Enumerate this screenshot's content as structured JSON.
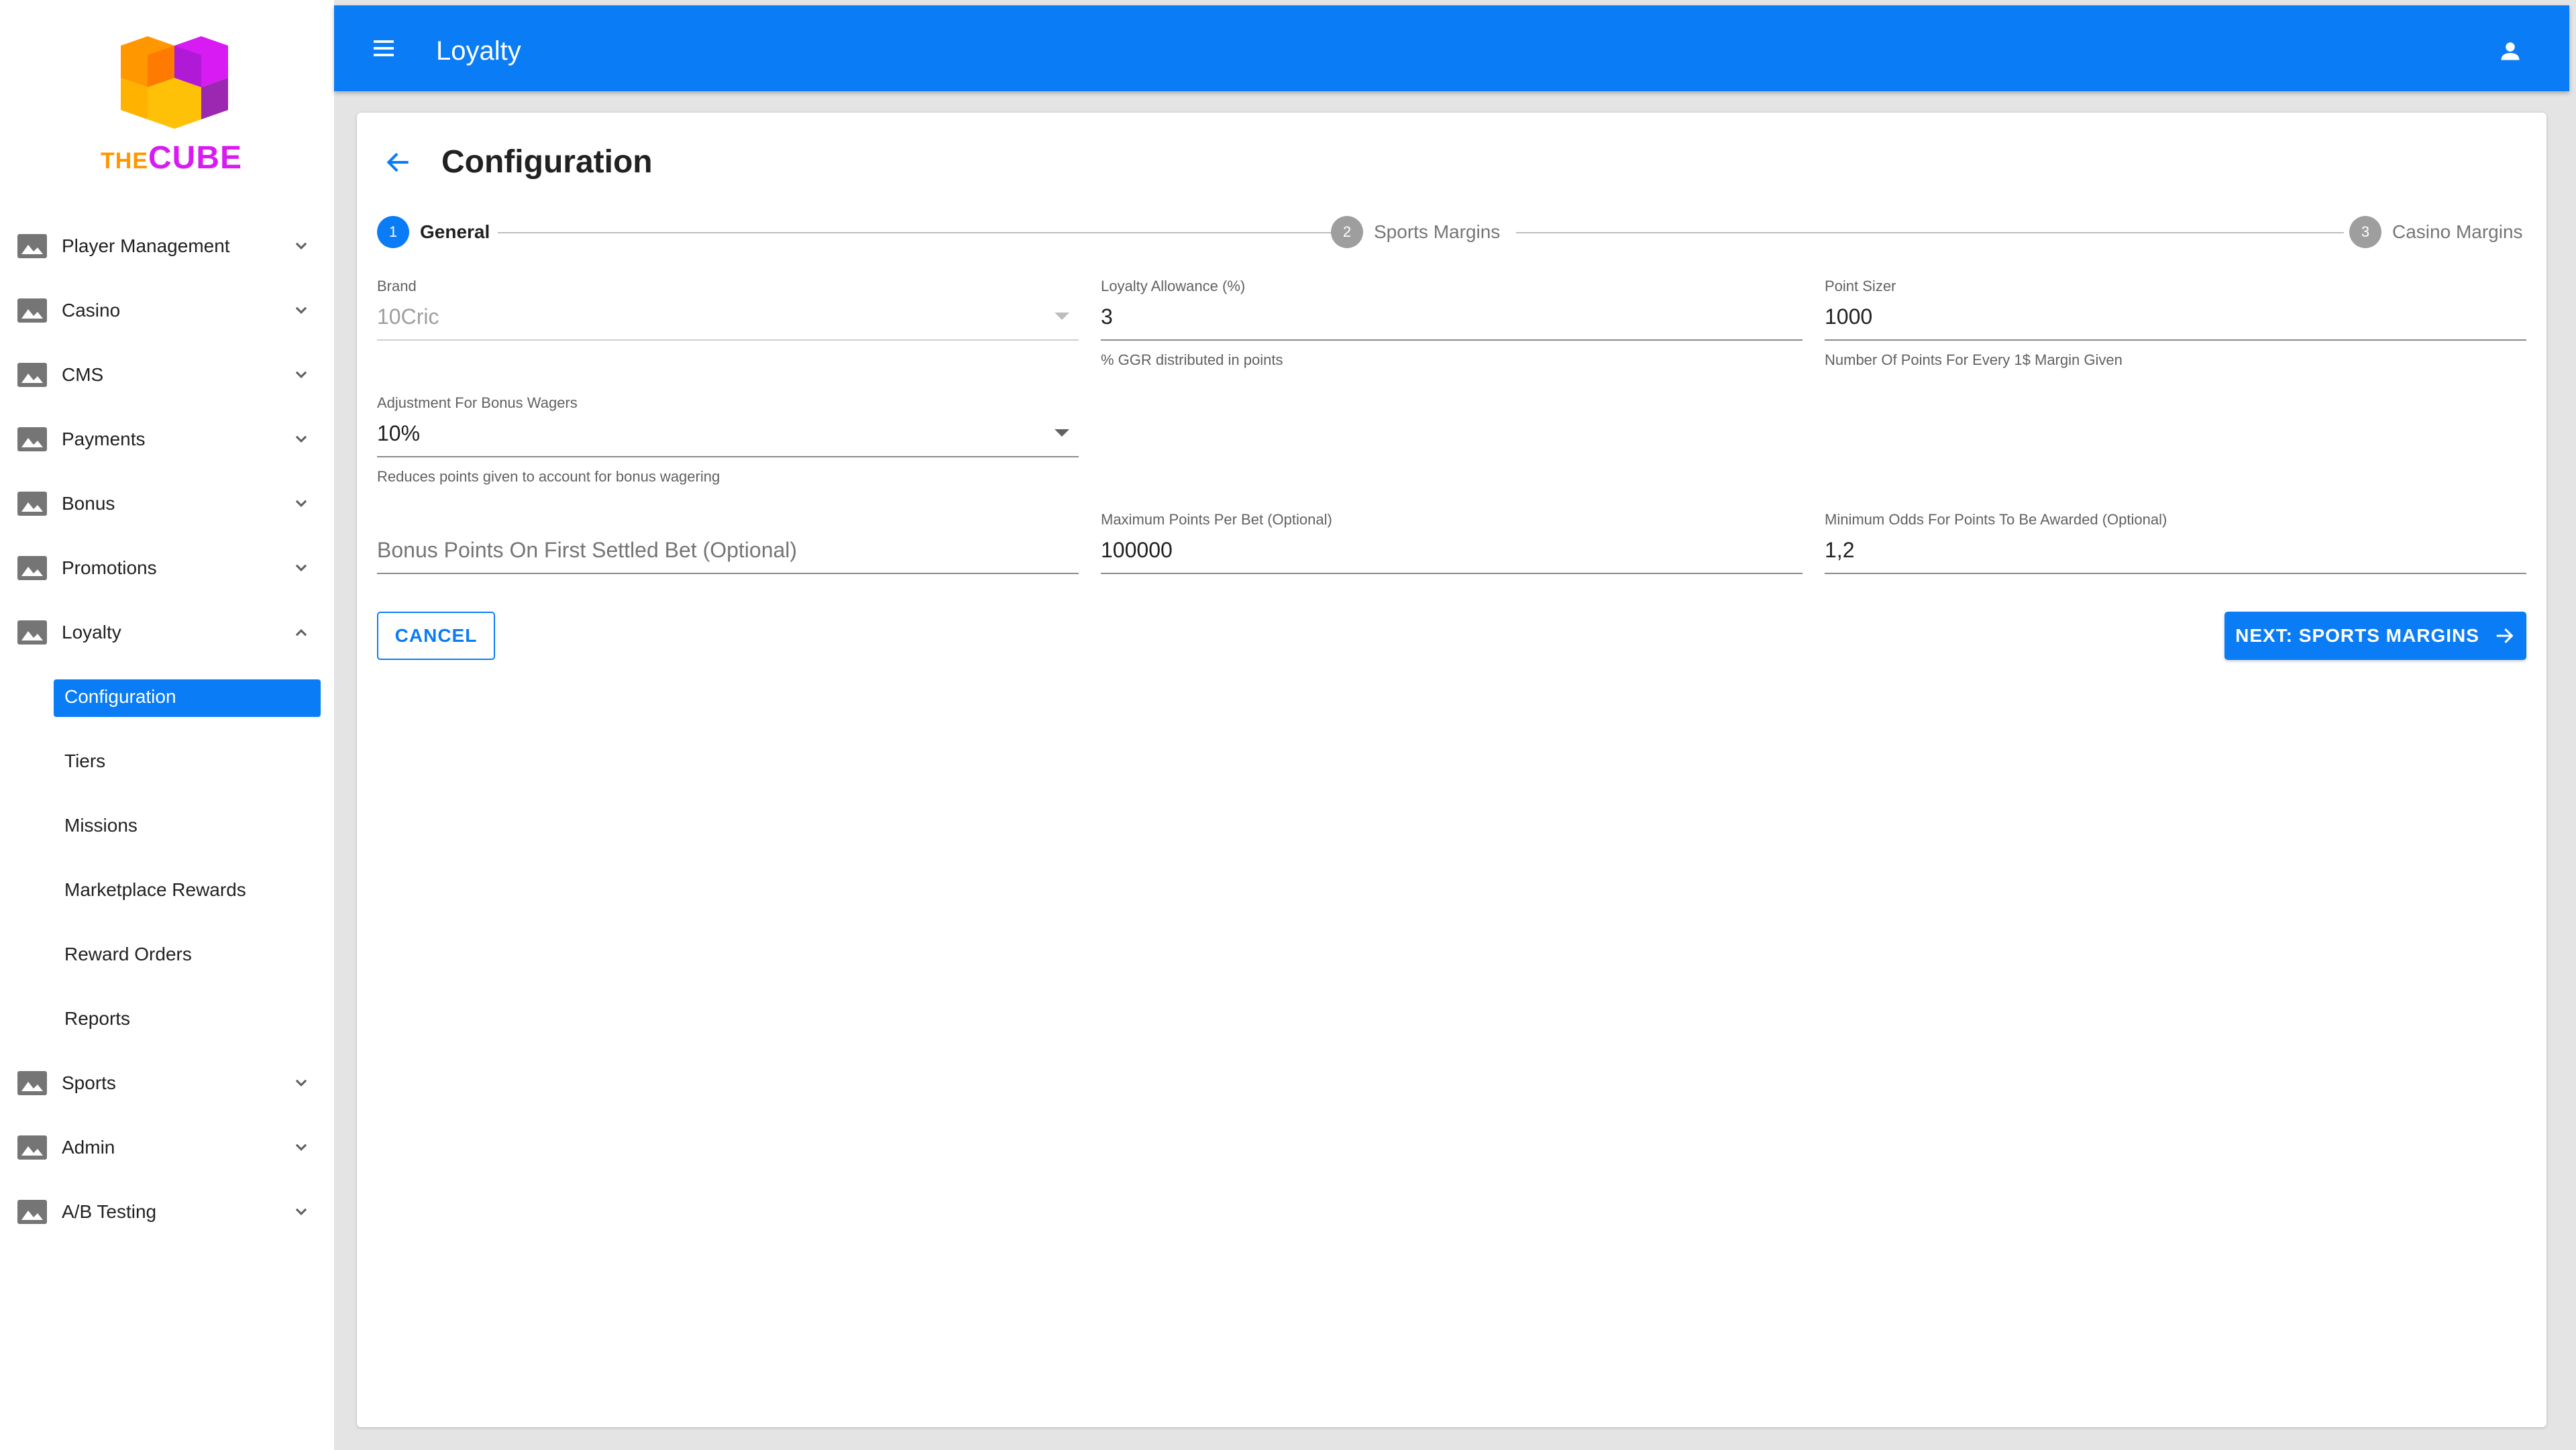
{
  "brand": {
    "prefix": "THE",
    "name": "CUBE"
  },
  "sidebar": {
    "items": [
      {
        "label": "Player Management",
        "expanded": false
      },
      {
        "label": "Casino",
        "expanded": false
      },
      {
        "label": "CMS",
        "expanded": false
      },
      {
        "label": "Payments",
        "expanded": false
      },
      {
        "label": "Bonus",
        "expanded": false
      },
      {
        "label": "Promotions",
        "expanded": false
      },
      {
        "label": "Loyalty",
        "expanded": true
      }
    ],
    "loyalty_sub": [
      "Configuration",
      "Tiers",
      "Missions",
      "Marketplace Rewards",
      "Reward Orders",
      "Reports"
    ],
    "active_sub": "Configuration",
    "bottom_items": [
      {
        "label": "Sports",
        "expanded": false
      },
      {
        "label": "Admin",
        "expanded": false
      },
      {
        "label": "A/B Testing",
        "expanded": false
      }
    ]
  },
  "topbar": {
    "title": "Loyalty"
  },
  "page": {
    "title": "Configuration"
  },
  "stepper": {
    "steps": [
      {
        "number": "1",
        "label": "General",
        "active": true
      },
      {
        "number": "2",
        "label": "Sports Margins",
        "active": false
      },
      {
        "number": "3",
        "label": "Casino Margins",
        "active": false
      }
    ]
  },
  "form": {
    "brand": {
      "label": "Brand",
      "value": "10Cric"
    },
    "loyalty_allowance": {
      "label": "Loyalty Allowance (%)",
      "value": "3",
      "helper": "% GGR distributed in points"
    },
    "point_sizer": {
      "label": "Point Sizer",
      "value": "1000",
      "helper": "Number Of Points For Every 1$ Margin Given"
    },
    "bonus_adjustment": {
      "label": "Adjustment For Bonus Wagers",
      "value": "10%",
      "helper": "Reduces points given to account for bonus wagering"
    },
    "bonus_first_bet": {
      "placeholder": "Bonus Points On First Settled Bet (Optional)"
    },
    "max_points": {
      "label": "Maximum Points Per Bet (Optional)",
      "value": "100000"
    },
    "min_odds": {
      "label": "Minimum Odds For Points To Be Awarded (Optional)",
      "value": "1,2"
    }
  },
  "actions": {
    "cancel": "CANCEL",
    "next": "NEXT: SPORTS MARGINS"
  },
  "colors": {
    "primary": "#0a7cf6",
    "logo_orange": "#ff9800",
    "logo_magenta": "#d81bf3"
  }
}
